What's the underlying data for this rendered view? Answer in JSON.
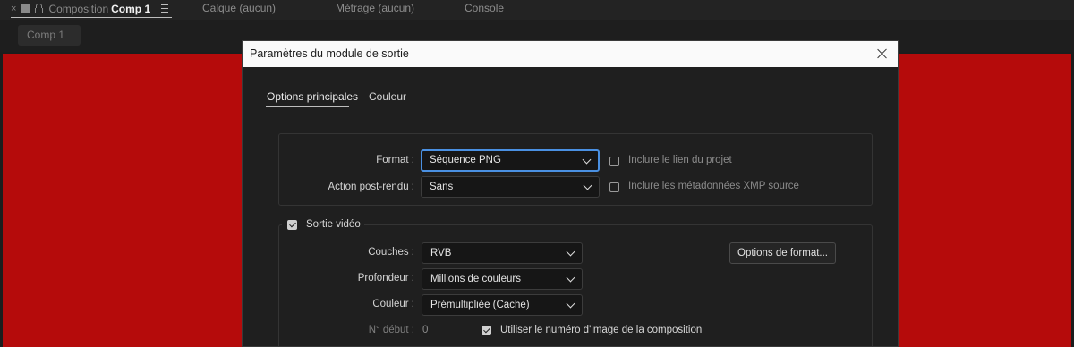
{
  "topbar": {
    "close_glyph": "×",
    "comp_prefix": "Composition",
    "comp_name": "Comp 1",
    "tabs": [
      "Calque (aucun)",
      "Métrage (aucun)",
      "Console"
    ]
  },
  "viewer": {
    "comp_chip": "Comp 1",
    "background_color": "#b50b0b"
  },
  "dialog": {
    "title": "Paramètres du module de sortie",
    "tabs": [
      {
        "label": "Options principales",
        "active": true
      },
      {
        "label": "Couleur",
        "active": false
      }
    ],
    "format": {
      "label": "Format :",
      "value": "Séquence PNG",
      "post_render_label": "Action post-rendu :",
      "post_render_value": "Sans",
      "include_project_link": {
        "label": "Inclure le lien du projet",
        "checked": false
      },
      "include_xmp": {
        "label": "Inclure les métadonnées XMP source",
        "checked": false
      }
    },
    "video": {
      "section_label": "Sortie vidéo",
      "enabled": true,
      "channels_label": "Couches :",
      "channels_value": "RVB",
      "depth_label": "Profondeur :",
      "depth_value": "Millions de couleurs",
      "color_label": "Couleur :",
      "color_value": "Prémultipliée (Cache)",
      "format_options_button": "Options de format...",
      "start_label": "N° début :",
      "start_value": "0",
      "use_comp_frame": {
        "label": "Utiliser le numéro d'image de la composition",
        "checked": true
      }
    }
  },
  "colors": {
    "accent_focus": "#4a90e2",
    "red_background": "#b50b0b"
  }
}
